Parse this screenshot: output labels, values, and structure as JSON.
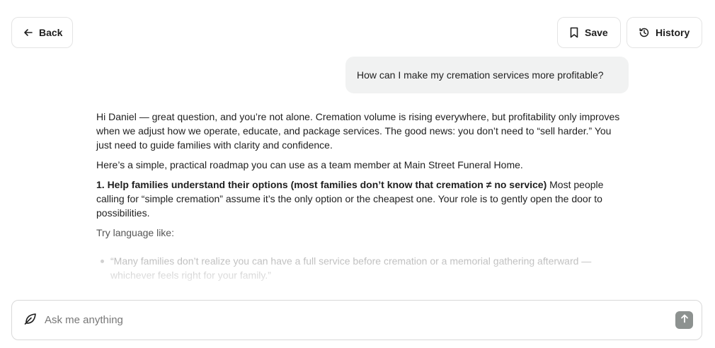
{
  "header": {
    "back_label": "Back",
    "save_label": "Save",
    "history_label": "History"
  },
  "conversation": {
    "user_message": "How can I make my cremation services more profitable?",
    "answer": {
      "intro": "Hi Daniel — great question, and you’re not alone. Cremation volume is rising everywhere, but profitability only improves when we adjust how we operate, educate, and package services. The good news: you don’t need to “sell harder.” You just need to guide families with clarity and confidence.",
      "roadmap": "Here’s a simple, practical roadmap you can use as a team member at Main Street Funeral Home.",
      "point1_heading": "1. Help families understand their options (most families don’t know that cremation ≠ no service)",
      "point1_body": " Most people calling for “simple cremation” assume it’s the only option or the cheapest one. Your role is to gently open the door to possibilities.",
      "try_language": "Try language like:",
      "bullets": [
        "“Many families don’t realize you can have a full service before cremation or a memorial gathering afterward — whichever feels right for your family.”"
      ]
    }
  },
  "composer": {
    "placeholder": "Ask me anything"
  },
  "icons": {
    "back": "arrow-left-icon",
    "save": "bookmark-icon",
    "history": "history-icon",
    "composer": "leaf-icon",
    "send": "arrow-up-icon"
  },
  "colors": {
    "bubble_bg": "#f1f2f2",
    "send_button": "#8d9290",
    "border": "#e4e4e4"
  }
}
